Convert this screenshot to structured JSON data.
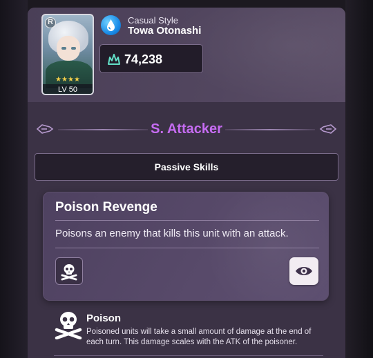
{
  "character": {
    "style_label": "Casual Style",
    "name": "Towa Otonashi",
    "rank_letter": "R",
    "stars": "★★★★",
    "level": "LV 50",
    "power": "74,238",
    "element_icon": "water-drop-icon",
    "power_icon": "flame-icon"
  },
  "role": {
    "title": "S. Attacker",
    "color": "#c66cf2"
  },
  "section": {
    "label": "Passive Skills"
  },
  "skill": {
    "name": "Poison Revenge",
    "description": "Poisons an enemy that kills this unit with an attack.",
    "status_icon": "skull-crossbones-icon",
    "detail_icon": "eye-icon"
  },
  "status_effect": {
    "name": "Poison",
    "description": "Poisoned units will take a small amount of damage at the end of each turn. This damage scales with the ATK of the poisoner."
  },
  "colors": {
    "panel": "#3b3245",
    "accent": "#c66cf2",
    "element": "#1a8ce8"
  }
}
